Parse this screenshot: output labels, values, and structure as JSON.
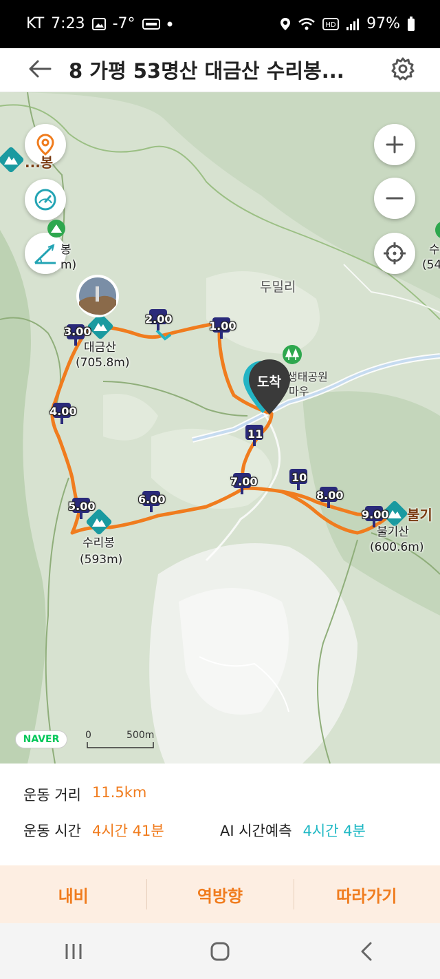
{
  "status_bar": {
    "carrier": "KT",
    "time": "7:23",
    "temperature": "-7°",
    "battery": "97%",
    "icons": [
      "image-icon",
      "gom-icon",
      "dot-icon",
      "location-icon",
      "wifi-icon",
      "hd-icon",
      "signal-icon",
      "battery-icon"
    ]
  },
  "header": {
    "title": "8 가평 53명산 대금산 수리봉...",
    "back_icon": "back-arrow-icon",
    "settings_icon": "gear-icon"
  },
  "map": {
    "controls": [
      "location-pin-icon",
      "speedometer-icon",
      "slope-icon",
      "zoom-in-icon",
      "zoom-out-icon",
      "crosshair-icon"
    ],
    "km_markers": [
      "1.00",
      "2.00",
      "3.00",
      "4.00",
      "5.00",
      "6.00",
      "7.00",
      "8.00",
      "9.00",
      "10",
      "11"
    ],
    "peaks": [
      {
        "name": "대금산",
        "elevation": "(705.8m)"
      },
      {
        "name": "수리봉",
        "elevation": "(593m)"
      },
      {
        "name": "불기산",
        "elevation": "(600.6m)"
      }
    ],
    "partial_peaks": {
      "left_top": "...봉",
      "left_mid_name": "봉",
      "left_mid_elev": "m)",
      "right_name": "수",
      "right_elev": "(54",
      "right_edge": "불기"
    },
    "place_label": "두밀리",
    "park_label_1": "생태공원",
    "park_label_2": "마우",
    "arrival_label": "도착",
    "naver_badge": "NAVER",
    "scale_zero": "0",
    "scale_value": "500m",
    "route_color": "#f07c1e",
    "marker_color": "#2a2a7a"
  },
  "info": {
    "distance_label": "운동 거리",
    "distance_value": "11.5km",
    "time_label": "운동 시간",
    "time_value": "4시간 41분",
    "ai_label": "AI 시간예측",
    "ai_value": "4시간 4분"
  },
  "actions": {
    "navi": "내비",
    "reverse": "역방향",
    "follow": "따라가기"
  },
  "nav_bar": [
    "recent-apps-icon",
    "home-icon",
    "back-icon"
  ]
}
